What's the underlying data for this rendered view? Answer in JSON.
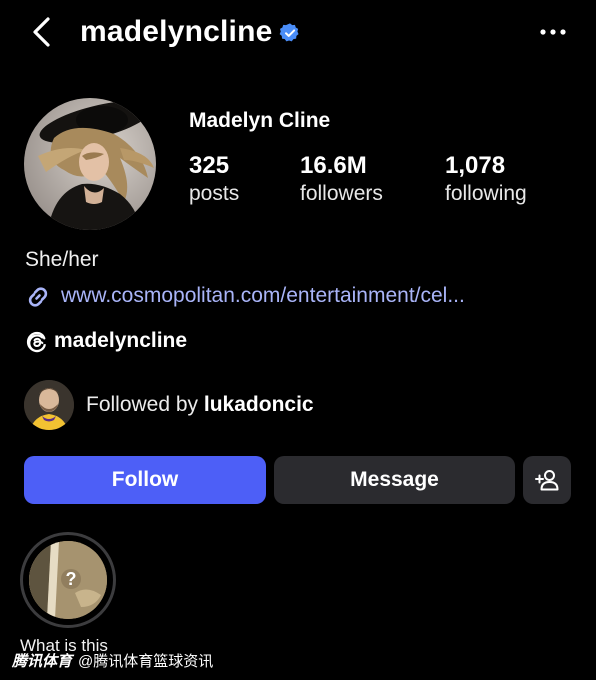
{
  "header": {
    "back_icon": "chevron-left-icon",
    "username": "madelyncline",
    "verified_icon": "verified-badge-icon",
    "more_icon": "more-horizontal-icon"
  },
  "profile": {
    "display_name": "Madelyn Cline",
    "stats": [
      {
        "value": "325",
        "label": "posts"
      },
      {
        "value": "16.6M",
        "label": "followers"
      },
      {
        "value": "1,078",
        "label": "following"
      }
    ],
    "bio": "She/her",
    "link": "www.cosmopolitan.com/entertainment/cel...",
    "link_icon": "link-icon",
    "threads_icon": "threads-icon",
    "threads_handle": "madelyncline"
  },
  "followed_by": {
    "prefix": "Followed by ",
    "user": "lukadoncic"
  },
  "actions": {
    "follow_label": "Follow",
    "message_label": "Message",
    "add_user_icon": "add-user-icon"
  },
  "highlights": [
    {
      "label": "What is this"
    }
  ],
  "watermark": {
    "brand": "腾讯体育",
    "handle": "@腾讯体育篮球资讯"
  },
  "colors": {
    "background": "#000000",
    "follow_button": "#4d5ff7",
    "secondary_button": "#2b2b2f",
    "link": "#a9b4f8",
    "verified": "#4a8df8"
  }
}
